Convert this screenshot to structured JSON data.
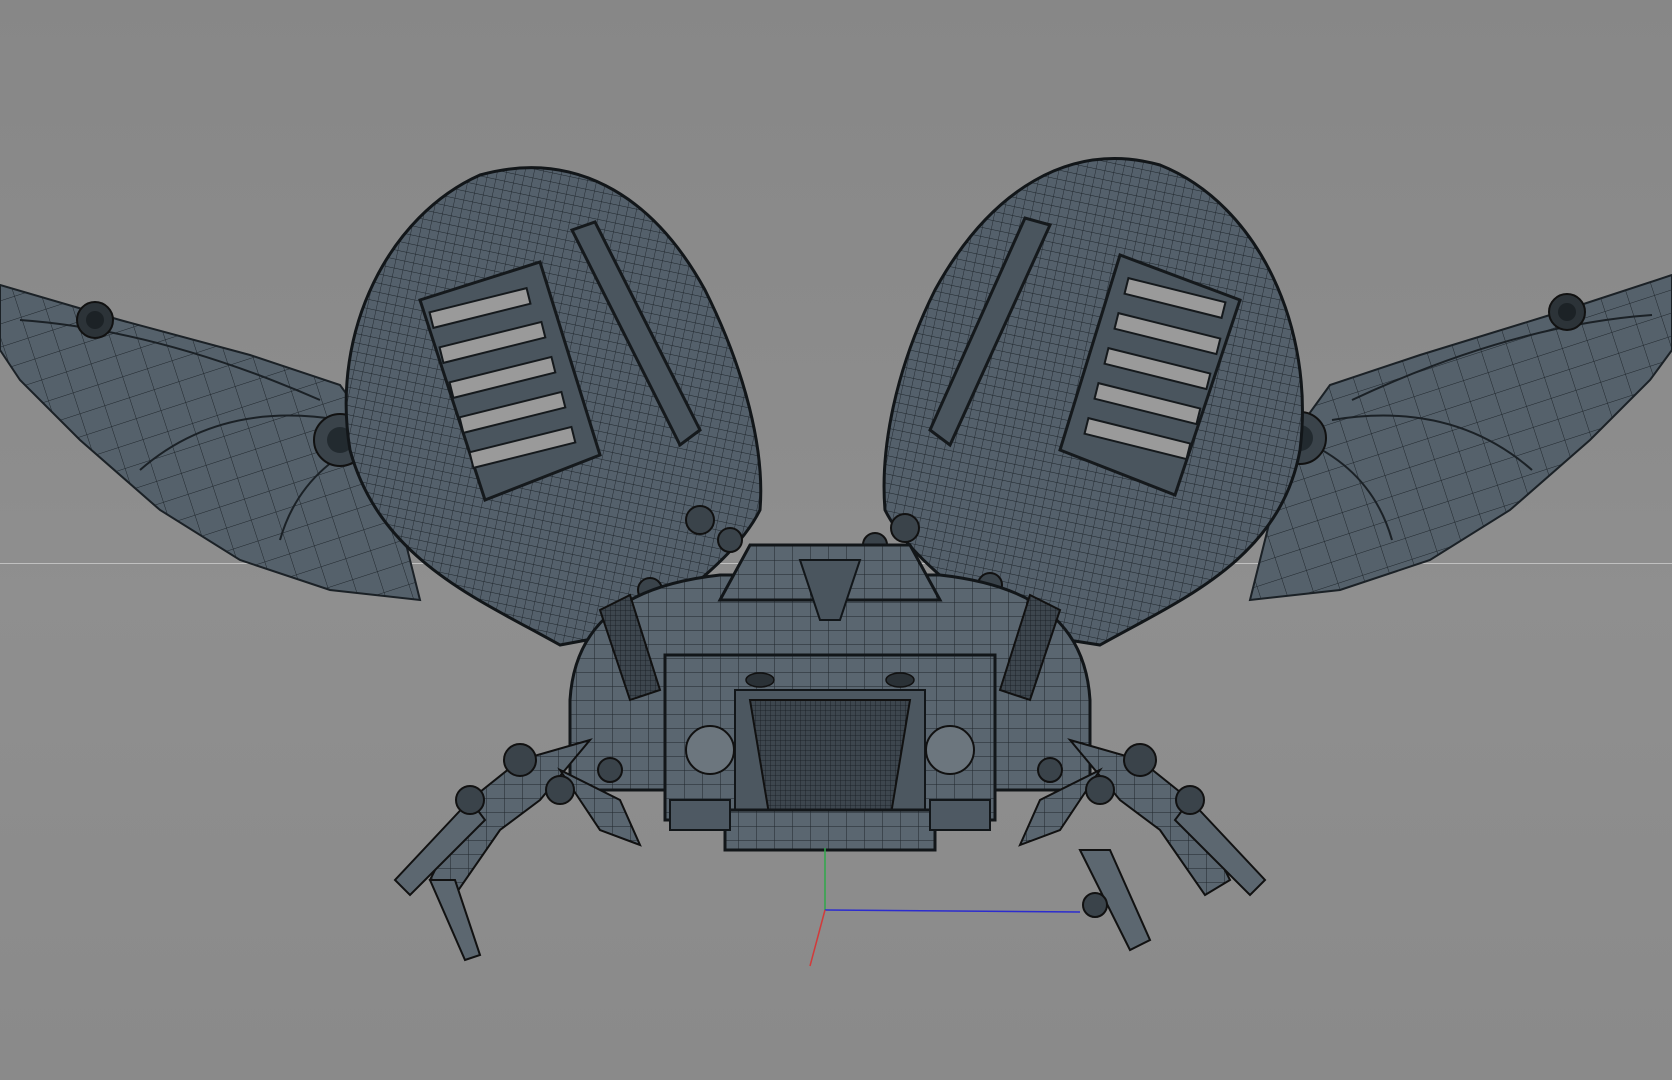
{
  "scene": {
    "viewport_background": "#8c8c8c",
    "mesh_fill": "#4e5963",
    "mesh_line": "#1a1f24",
    "horizon_color": "#c9c9c9"
  },
  "axis_gizmo": {
    "x_color": "#2c2ccf",
    "y_color": "#2fa84a",
    "z_color": "#d23a3a"
  },
  "model": {
    "type": "robotic-beetle-wireframe"
  }
}
